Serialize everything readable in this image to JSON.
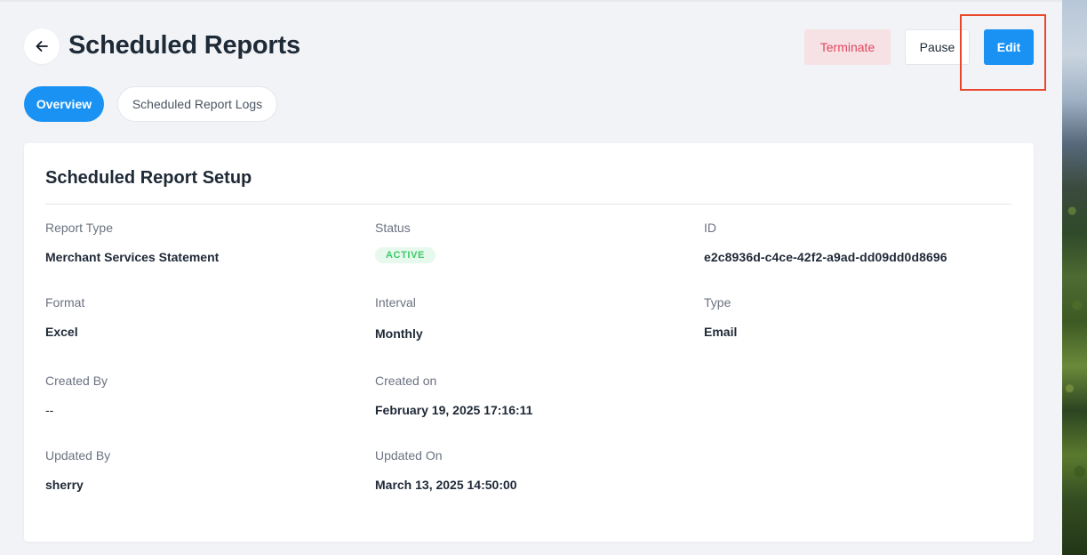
{
  "header": {
    "title": "Scheduled Reports",
    "buttons": {
      "terminate": "Terminate",
      "pause": "Pause",
      "edit": "Edit"
    }
  },
  "tabs": {
    "overview": "Overview",
    "logs": "Scheduled Report Logs"
  },
  "card": {
    "title": "Scheduled Report Setup",
    "fields": {
      "report_type": {
        "label": "Report Type",
        "value": "Merchant Services Statement"
      },
      "status": {
        "label": "Status",
        "value": "ACTIVE"
      },
      "id": {
        "label": "ID",
        "value": "e2c8936d-c4ce-42f2-a9ad-dd09dd0d8696"
      },
      "format": {
        "label": "Format",
        "value": "Excel"
      },
      "interval": {
        "label": "Interval",
        "value": "Monthly"
      },
      "type": {
        "label": "Type",
        "value": "Email"
      },
      "created_by": {
        "label": "Created By",
        "value": "--"
      },
      "created_on": {
        "label": "Created on",
        "value": "February 19, 2025 17:16:11"
      },
      "updated_by": {
        "label": "Updated By",
        "value": "sherry"
      },
      "updated_on": {
        "label": "Updated On",
        "value": "March 13, 2025 14:50:00"
      }
    }
  },
  "colors": {
    "primary": "#1992f4",
    "danger_text": "#e0485f",
    "danger_bg": "#f6e1e4",
    "success_text": "#3ecb6a",
    "success_bg": "#e7f8ec",
    "highlight": "#e8472b"
  },
  "icons": {
    "back": "arrow-left-icon"
  }
}
